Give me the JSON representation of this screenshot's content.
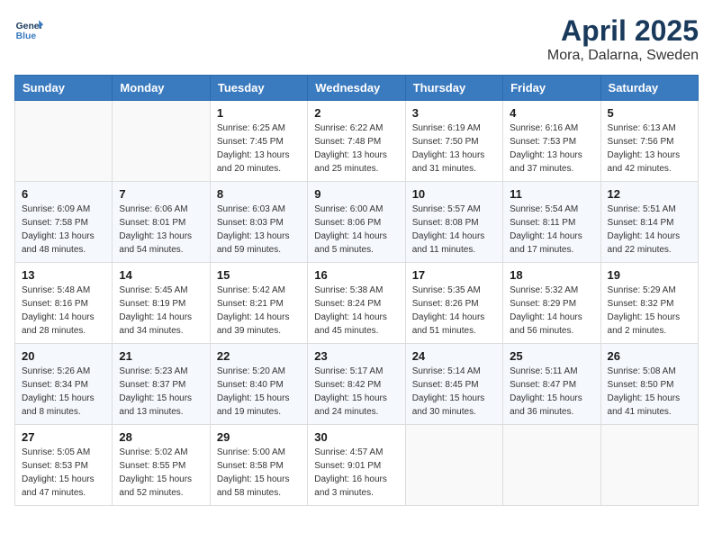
{
  "header": {
    "logo_line1": "General",
    "logo_line2": "Blue",
    "month": "April 2025",
    "location": "Mora, Dalarna, Sweden"
  },
  "weekdays": [
    "Sunday",
    "Monday",
    "Tuesday",
    "Wednesday",
    "Thursday",
    "Friday",
    "Saturday"
  ],
  "weeks": [
    [
      {
        "day": "",
        "info": ""
      },
      {
        "day": "",
        "info": ""
      },
      {
        "day": "1",
        "info": "Sunrise: 6:25 AM\nSunset: 7:45 PM\nDaylight: 13 hours\nand 20 minutes."
      },
      {
        "day": "2",
        "info": "Sunrise: 6:22 AM\nSunset: 7:48 PM\nDaylight: 13 hours\nand 25 minutes."
      },
      {
        "day": "3",
        "info": "Sunrise: 6:19 AM\nSunset: 7:50 PM\nDaylight: 13 hours\nand 31 minutes."
      },
      {
        "day": "4",
        "info": "Sunrise: 6:16 AM\nSunset: 7:53 PM\nDaylight: 13 hours\nand 37 minutes."
      },
      {
        "day": "5",
        "info": "Sunrise: 6:13 AM\nSunset: 7:56 PM\nDaylight: 13 hours\nand 42 minutes."
      }
    ],
    [
      {
        "day": "6",
        "info": "Sunrise: 6:09 AM\nSunset: 7:58 PM\nDaylight: 13 hours\nand 48 minutes."
      },
      {
        "day": "7",
        "info": "Sunrise: 6:06 AM\nSunset: 8:01 PM\nDaylight: 13 hours\nand 54 minutes."
      },
      {
        "day": "8",
        "info": "Sunrise: 6:03 AM\nSunset: 8:03 PM\nDaylight: 13 hours\nand 59 minutes."
      },
      {
        "day": "9",
        "info": "Sunrise: 6:00 AM\nSunset: 8:06 PM\nDaylight: 14 hours\nand 5 minutes."
      },
      {
        "day": "10",
        "info": "Sunrise: 5:57 AM\nSunset: 8:08 PM\nDaylight: 14 hours\nand 11 minutes."
      },
      {
        "day": "11",
        "info": "Sunrise: 5:54 AM\nSunset: 8:11 PM\nDaylight: 14 hours\nand 17 minutes."
      },
      {
        "day": "12",
        "info": "Sunrise: 5:51 AM\nSunset: 8:14 PM\nDaylight: 14 hours\nand 22 minutes."
      }
    ],
    [
      {
        "day": "13",
        "info": "Sunrise: 5:48 AM\nSunset: 8:16 PM\nDaylight: 14 hours\nand 28 minutes."
      },
      {
        "day": "14",
        "info": "Sunrise: 5:45 AM\nSunset: 8:19 PM\nDaylight: 14 hours\nand 34 minutes."
      },
      {
        "day": "15",
        "info": "Sunrise: 5:42 AM\nSunset: 8:21 PM\nDaylight: 14 hours\nand 39 minutes."
      },
      {
        "day": "16",
        "info": "Sunrise: 5:38 AM\nSunset: 8:24 PM\nDaylight: 14 hours\nand 45 minutes."
      },
      {
        "day": "17",
        "info": "Sunrise: 5:35 AM\nSunset: 8:26 PM\nDaylight: 14 hours\nand 51 minutes."
      },
      {
        "day": "18",
        "info": "Sunrise: 5:32 AM\nSunset: 8:29 PM\nDaylight: 14 hours\nand 56 minutes."
      },
      {
        "day": "19",
        "info": "Sunrise: 5:29 AM\nSunset: 8:32 PM\nDaylight: 15 hours\nand 2 minutes."
      }
    ],
    [
      {
        "day": "20",
        "info": "Sunrise: 5:26 AM\nSunset: 8:34 PM\nDaylight: 15 hours\nand 8 minutes."
      },
      {
        "day": "21",
        "info": "Sunrise: 5:23 AM\nSunset: 8:37 PM\nDaylight: 15 hours\nand 13 minutes."
      },
      {
        "day": "22",
        "info": "Sunrise: 5:20 AM\nSunset: 8:40 PM\nDaylight: 15 hours\nand 19 minutes."
      },
      {
        "day": "23",
        "info": "Sunrise: 5:17 AM\nSunset: 8:42 PM\nDaylight: 15 hours\nand 24 minutes."
      },
      {
        "day": "24",
        "info": "Sunrise: 5:14 AM\nSunset: 8:45 PM\nDaylight: 15 hours\nand 30 minutes."
      },
      {
        "day": "25",
        "info": "Sunrise: 5:11 AM\nSunset: 8:47 PM\nDaylight: 15 hours\nand 36 minutes."
      },
      {
        "day": "26",
        "info": "Sunrise: 5:08 AM\nSunset: 8:50 PM\nDaylight: 15 hours\nand 41 minutes."
      }
    ],
    [
      {
        "day": "27",
        "info": "Sunrise: 5:05 AM\nSunset: 8:53 PM\nDaylight: 15 hours\nand 47 minutes."
      },
      {
        "day": "28",
        "info": "Sunrise: 5:02 AM\nSunset: 8:55 PM\nDaylight: 15 hours\nand 52 minutes."
      },
      {
        "day": "29",
        "info": "Sunrise: 5:00 AM\nSunset: 8:58 PM\nDaylight: 15 hours\nand 58 minutes."
      },
      {
        "day": "30",
        "info": "Sunrise: 4:57 AM\nSunset: 9:01 PM\nDaylight: 16 hours\nand 3 minutes."
      },
      {
        "day": "",
        "info": ""
      },
      {
        "day": "",
        "info": ""
      },
      {
        "day": "",
        "info": ""
      }
    ]
  ]
}
